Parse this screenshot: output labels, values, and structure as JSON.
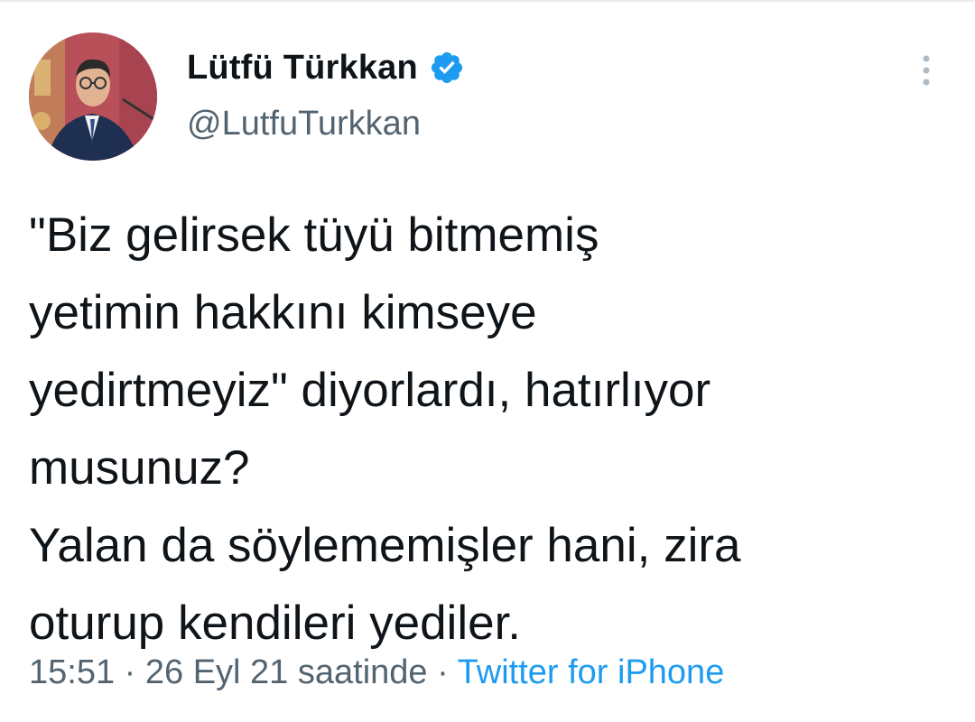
{
  "colors": {
    "text_primary": "#0f1419",
    "text_secondary": "#536471",
    "accent": "#1d9bf0"
  },
  "author": {
    "display_name": "Lütfü Türkkan",
    "handle": "@LutfuTurkkan",
    "verified_icon": "verified-badge-icon",
    "avatar": "profile-photo"
  },
  "tweet": {
    "lines": [
      "\"Biz gelirsek tüyü bitmemiş",
      "yetimin hakkını kimseye",
      "yedirtmeyiz\" diyorlardı, hatırlıyor",
      "musunuz?",
      "Yalan da söylememişler hani, zira",
      "oturup kendileri yediler."
    ]
  },
  "meta": {
    "time": "15:51",
    "separator": "·",
    "date": "26 Eyl 21 saatinde",
    "source": "Twitter for iPhone"
  },
  "menu_icon": "more-vertical-icon"
}
